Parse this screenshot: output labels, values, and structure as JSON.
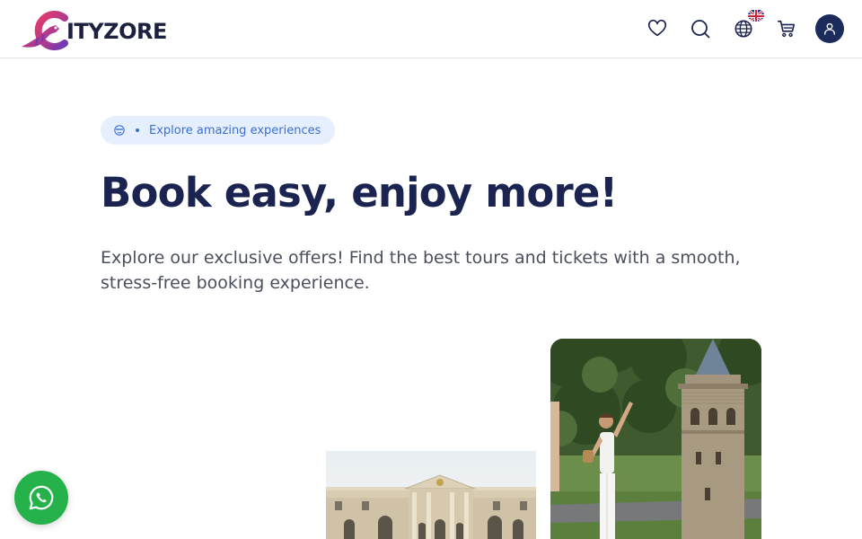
{
  "header": {
    "logo_text": "ITYZORE",
    "icons": {
      "wishlist": "heart-icon",
      "search": "search-icon",
      "language": "globe-icon",
      "language_flag": "uk-flag-icon",
      "cart": "cart-icon",
      "account": "user-icon"
    }
  },
  "hero": {
    "badge_text": "Explore amazing experiences",
    "title": "Book easy, enjoy more!",
    "subtitle": "Explore our exclusive offers! Find the best tours and tickets with a smooth, stress-free booking experience."
  },
  "images": {
    "palace": "palace-photo",
    "tower": "galata-tower-photo"
  },
  "floating": {
    "whatsapp": "whatsapp-icon"
  },
  "colors": {
    "brand_navy": "#1b2450",
    "accent_blue": "#3b6fd8",
    "badge_bg": "#e6effd",
    "whatsapp_green": "#25b24a",
    "avatar_bg": "#1a2b5c"
  }
}
